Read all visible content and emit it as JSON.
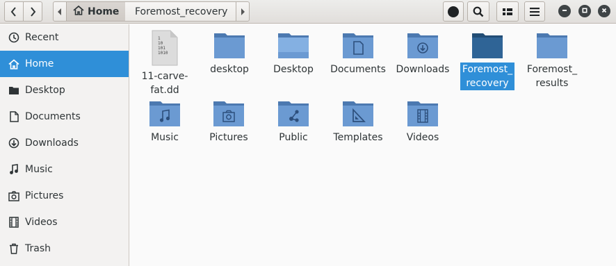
{
  "header": {
    "breadcrumb_home": "Home",
    "breadcrumb_current": "Foremost_recovery"
  },
  "sidebar": {
    "items": [
      {
        "label": "Recent",
        "icon": "clock-icon"
      },
      {
        "label": "Home",
        "icon": "home-icon",
        "active": true
      },
      {
        "label": "Desktop",
        "icon": "desktop-icon"
      },
      {
        "label": "Documents",
        "icon": "document-icon"
      },
      {
        "label": "Downloads",
        "icon": "download-icon"
      },
      {
        "label": "Music",
        "icon": "music-icon"
      },
      {
        "label": "Pictures",
        "icon": "camera-icon"
      },
      {
        "label": "Videos",
        "icon": "film-icon"
      },
      {
        "label": "Trash",
        "icon": "trash-icon"
      }
    ]
  },
  "files": [
    {
      "line1": "11-carve-",
      "line2": "fat.dd",
      "kind": "binary-file"
    },
    {
      "line1": "desktop",
      "line2": "",
      "kind": "folder"
    },
    {
      "line1": "Desktop",
      "line2": "",
      "kind": "folder-desktop"
    },
    {
      "line1": "Documents",
      "line2": "",
      "kind": "folder-documents"
    },
    {
      "line1": "Downloads",
      "line2": "",
      "kind": "folder-downloads"
    },
    {
      "line1": "Foremost_",
      "line2": "recovery",
      "kind": "folder",
      "selected": true
    },
    {
      "line1": "Foremost_",
      "line2": "results",
      "kind": "folder"
    },
    {
      "line1": "Music",
      "line2": "",
      "kind": "folder-music"
    },
    {
      "line1": "Pictures",
      "line2": "",
      "kind": "folder-pictures"
    },
    {
      "line1": "Public",
      "line2": "",
      "kind": "folder-public"
    },
    {
      "line1": "Templates",
      "line2": "",
      "kind": "folder-templates"
    },
    {
      "line1": "Videos",
      "line2": "",
      "kind": "folder-videos"
    }
  ],
  "binary_file_glyph": [
    "1",
    "10",
    "101",
    "1010"
  ],
  "colors": {
    "accent": "#2f8fd8",
    "folder": "#5b8cc7",
    "folder_selected": "#2f6496"
  }
}
